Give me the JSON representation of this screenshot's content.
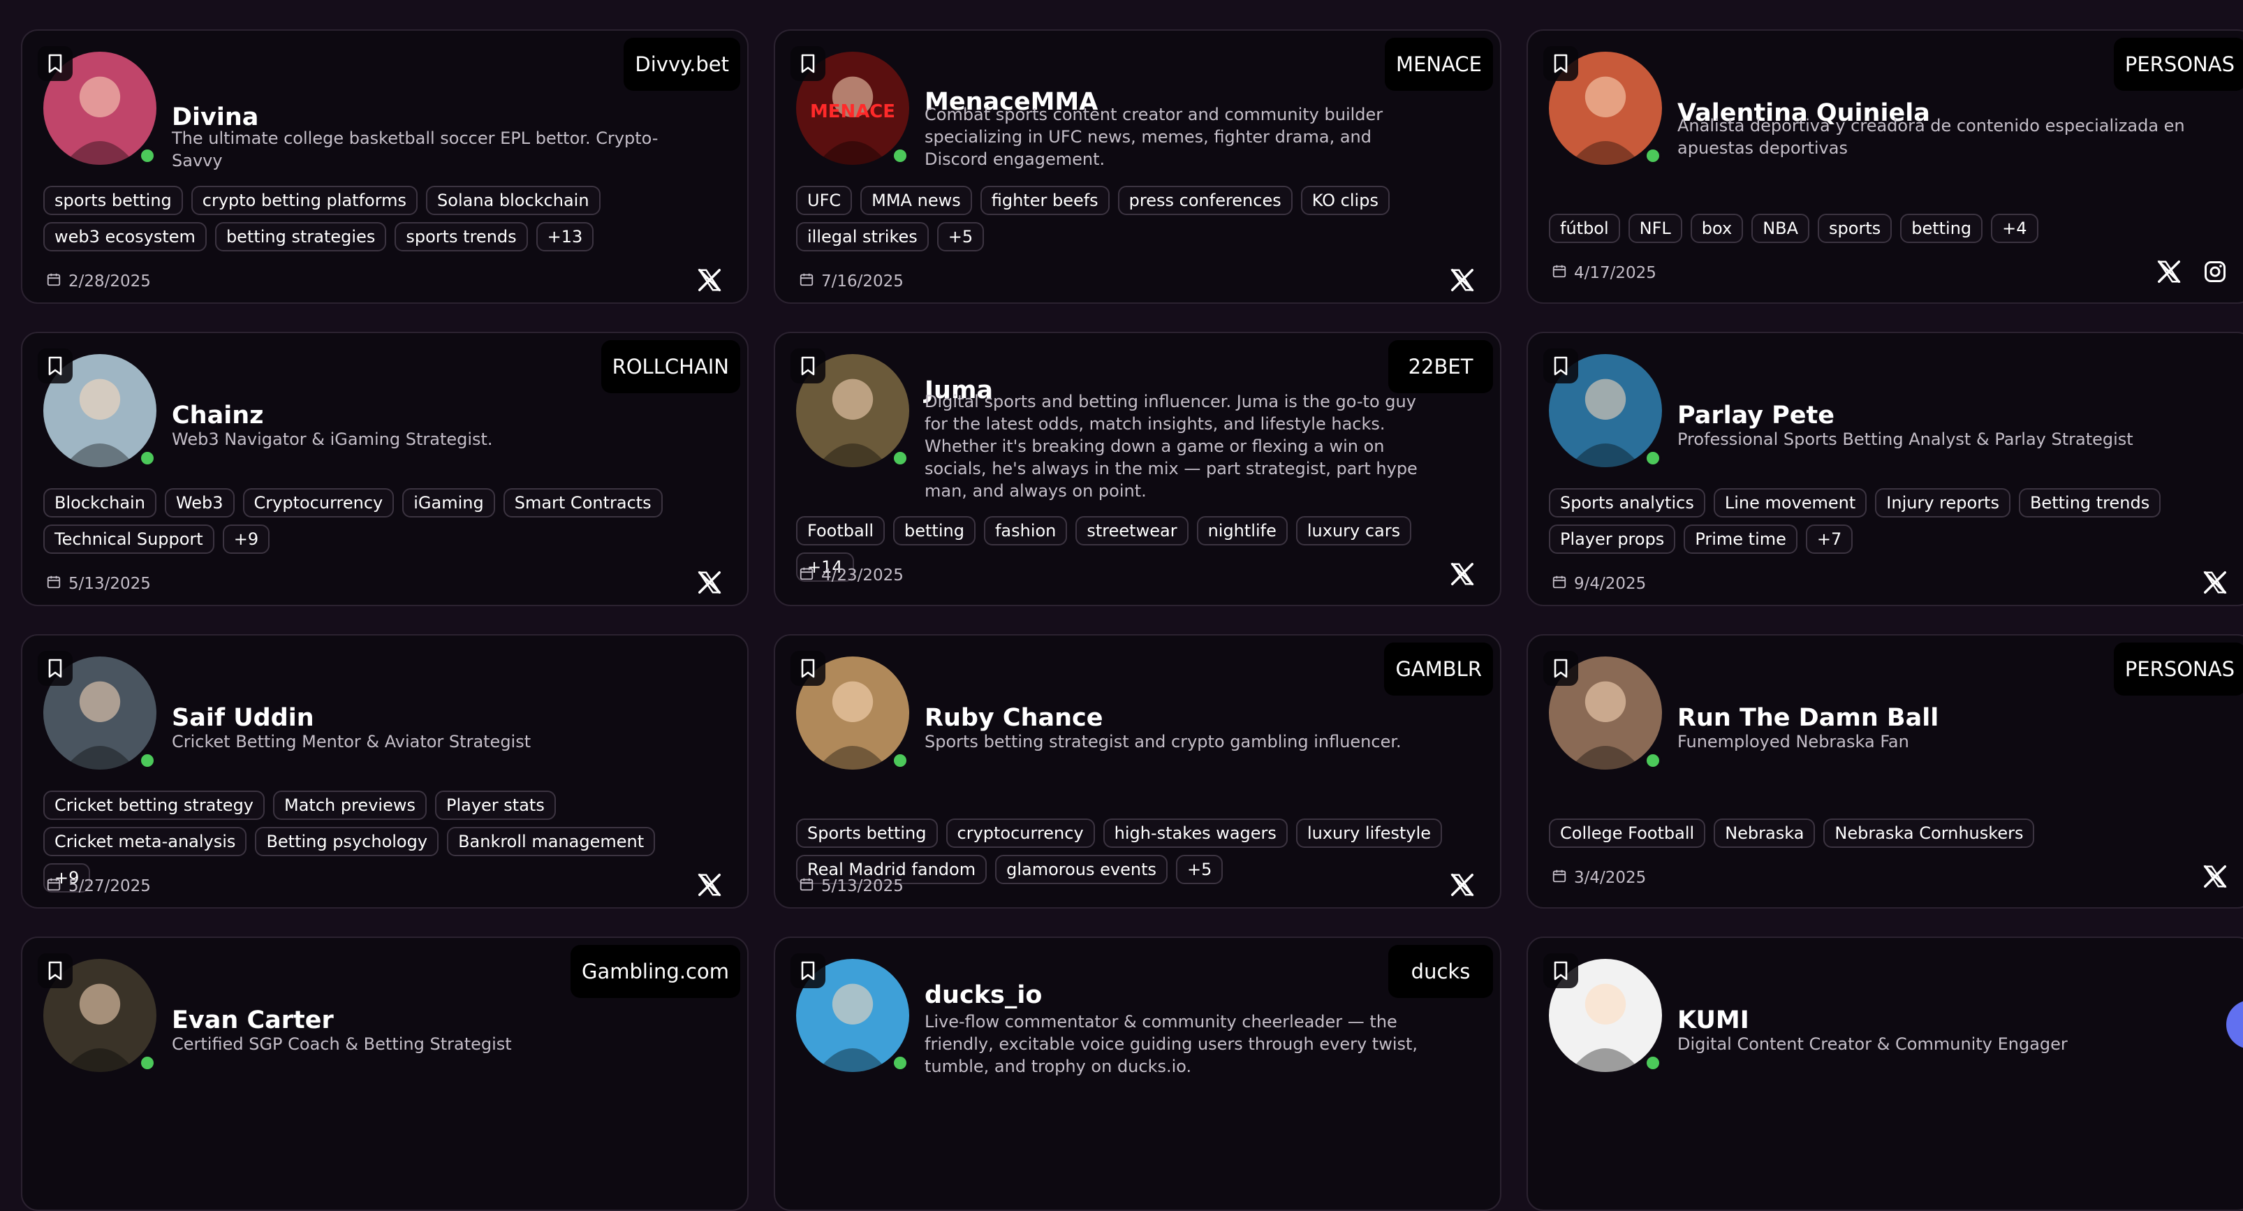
{
  "cards": [
    {
      "name": "Divina",
      "bio": "The ultimate college basketball soccer EPL bettor. Crypto-Savvy",
      "brand": "Divvy.bet",
      "tags": [
        "sports betting",
        "crypto betting platforms",
        "Solana blockchain",
        "web3 ecosystem",
        "betting strategies",
        "sports trends",
        "+13"
      ],
      "date": "2/28/2025",
      "socials": [
        "x-icon"
      ],
      "avatar_color": "#c0456a"
    },
    {
      "name": "MenaceMMA",
      "bio": "Combat sports content creator and community builder specializing in UFC news, memes, fighter drama, and Discord engagement.",
      "brand": "MENACE",
      "tags": [
        "UFC",
        "MMA news",
        "fighter beefs",
        "press conferences",
        "KO clips",
        "illegal strikes",
        "+5"
      ],
      "date": "7/16/2025",
      "socials": [
        "x-icon"
      ],
      "avatar_color": "#5a0f0f",
      "avatar_text": "MENACE"
    },
    {
      "name": "Valentina Quiniela",
      "bio": "Analista deportiva y creadora de contenido especializada en apuestas deportivas",
      "brand": "PERSONAS",
      "tags": [
        "fútbol",
        "NFL",
        "box",
        "NBA",
        "sports",
        "betting",
        "+4"
      ],
      "date": "4/17/2025",
      "socials": [
        "x-icon",
        "instagram-icon"
      ],
      "avatar_color": "#c85a3a"
    },
    {
      "name": "Chainz",
      "bio": "Web3 Navigator & iGaming Strategist.",
      "brand": "ROLLCHAIN",
      "tags": [
        "Blockchain",
        "Web3",
        "Cryptocurrency",
        "iGaming",
        "Smart Contracts",
        "Technical Support",
        "+9"
      ],
      "date": "5/13/2025",
      "socials": [
        "x-icon"
      ],
      "avatar_color": "#9fb6c4"
    },
    {
      "name": "Juma",
      "bio": "Digital sports and betting influencer. Juma is the go-to guy for the latest odds, match insights, and lifestyle hacks. Whether it's breaking down a game or flexing a win on socials, he's always in the mix — part strategist, part hype man, and always on point.",
      "brand": "22BET",
      "tags": [
        "Football",
        "betting",
        "fashion",
        "streetwear",
        "nightlife",
        "luxury cars",
        "+14"
      ],
      "date": "4/23/2025",
      "socials": [
        "x-icon"
      ],
      "avatar_color": "#6b5a3a"
    },
    {
      "name": "Parlay Pete",
      "bio": "Professional Sports Betting Analyst & Parlay Strategist",
      "brand": "",
      "tags": [
        "Sports analytics",
        "Line movement",
        "Injury reports",
        "Betting trends",
        "Player props",
        "Prime time",
        "+7"
      ],
      "date": "9/4/2025",
      "socials": [
        "x-icon"
      ],
      "avatar_color": "#2a6f9a"
    },
    {
      "name": "Saif Uddin",
      "bio": "Cricket Betting Mentor & Aviator Strategist",
      "brand": "",
      "tags": [
        "Cricket betting strategy",
        "Match previews",
        "Player stats",
        "Cricket meta-analysis",
        "Betting psychology",
        "Bankroll management",
        "+9"
      ],
      "date": "5/27/2025",
      "socials": [
        "x-icon"
      ],
      "avatar_color": "#4a5560"
    },
    {
      "name": "Ruby Chance",
      "bio": "Sports betting strategist and crypto gambling influencer.",
      "brand": "GAMBLR",
      "tags": [
        "Sports betting",
        "cryptocurrency",
        "high-stakes wagers",
        "luxury lifestyle",
        "Real Madrid fandom",
        "glamorous events",
        "+5"
      ],
      "date": "5/13/2025",
      "socials": [
        "x-icon"
      ],
      "avatar_color": "#b0895a"
    },
    {
      "name": "Run The Damn Ball",
      "bio": "Funemployed Nebraska Fan",
      "brand": "PERSONAS",
      "tags": [
        "College Football",
        "Nebraska",
        "Nebraska Cornhuskers"
      ],
      "date": "3/4/2025",
      "socials": [
        "x-icon"
      ],
      "avatar_color": "#8a6a55"
    },
    {
      "name": "Evan Carter",
      "bio": "Certified SGP Coach & Betting Strategist",
      "brand": "Gambling.com",
      "tags": [],
      "date": "",
      "socials": [],
      "avatar_color": "#3a3328"
    },
    {
      "name": "ducks_io",
      "bio": "Live-flow commentator & community cheerleader — the friendly, excitable voice guiding users through every twist, tumble, and trophy on ducks.io.",
      "brand": "ducks",
      "tags": [],
      "date": "",
      "socials": [],
      "avatar_color": "#3ea0d8"
    },
    {
      "name": "KUMI",
      "bio": "Digital Content Creator & Community Engager",
      "brand": "",
      "tags": [],
      "date": "",
      "socials": [],
      "avatar_color": "#f2f2f2"
    }
  ]
}
